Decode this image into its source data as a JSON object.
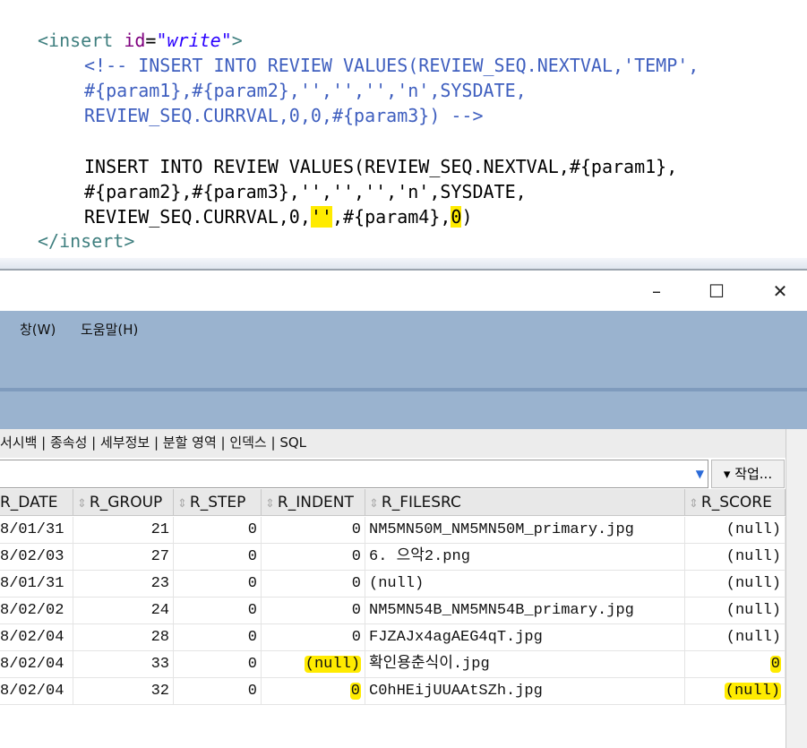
{
  "code": {
    "lines": [
      {
        "parts": [
          [
            "tag",
            "<insert "
          ],
          [
            "attr",
            "id"
          ],
          [
            "sql",
            "="
          ],
          [
            "val",
            "\"write\""
          ],
          [
            "tag",
            ">"
          ]
        ]
      },
      {
        "parts": [
          [
            "cmt",
            "<!-- INSERT INTO REVIEW VALUES(REVIEW_SEQ.NEXTVAL,'TEMP',"
          ]
        ]
      },
      {
        "parts": [
          [
            "cmt",
            "#{param1},#{param2},'','','','n',SYSDATE,"
          ]
        ]
      },
      {
        "parts": [
          [
            "cmt",
            "REVIEW_SEQ.CURRVAL,0,0,#{param3}) -->"
          ]
        ]
      },
      {
        "parts": []
      },
      {
        "parts": [
          [
            "sql",
            "INSERT INTO REVIEW VALUES(REVIEW_SEQ.NEXTVAL,#{param1},"
          ]
        ]
      },
      {
        "parts": [
          [
            "sql",
            "#{param2},#{param3},'','','','n',SYSDATE,"
          ]
        ]
      },
      {
        "parts": [
          [
            "sql",
            "REVIEW_SEQ.CURRVAL,0,"
          ],
          [
            "hl",
            "''"
          ],
          [
            "sql",
            ",#{param4},"
          ],
          [
            "hl",
            "0"
          ],
          [
            "sql",
            ")"
          ]
        ]
      },
      {
        "parts": [
          [
            "tag",
            "</insert>"
          ]
        ]
      }
    ]
  },
  "window": {
    "minimize": "–",
    "maximize": "☐",
    "close": "✕"
  },
  "menu": {
    "window": "창(W)",
    "help": "도움말(H)"
  },
  "tabs": "서시백 | 종속성 | 세부정보 | 분할 영역 | 인덱스 | SQL",
  "actions_label": "▾ 작업...",
  "filter_dropdown": "▼",
  "table": {
    "columns": [
      "R_DATE",
      "R_GROUP",
      "R_STEP",
      "R_INDENT",
      "R_FILESRC",
      "R_SCORE"
    ],
    "rows": [
      [
        "8/01/31",
        "21",
        "0",
        "0",
        "NM5MN50M_NM5MN50M_primary.jpg",
        "(null)"
      ],
      [
        "8/02/03",
        "27",
        "0",
        "0",
        "6. 으악2.png",
        "(null)"
      ],
      [
        "8/01/31",
        "23",
        "0",
        "0",
        "(null)",
        "(null)"
      ],
      [
        "8/02/02",
        "24",
        "0",
        "0",
        "NM5MN54B_NM5MN54B_primary.jpg",
        "(null)"
      ],
      [
        "8/02/04",
        "28",
        "0",
        "0",
        "FJZAJx4agAEG4qT.jpg",
        "(null)"
      ],
      [
        "8/02/04",
        "33",
        "0",
        "(null)",
        "확인용춘식이.jpg",
        "0"
      ],
      [
        "8/02/04",
        "32",
        "0",
        "0",
        "C0hHEijUUAAtSZh.jpg",
        "(null)"
      ]
    ],
    "highlighted": [
      [
        5,
        3
      ],
      [
        5,
        5
      ],
      [
        6,
        3
      ],
      [
        6,
        5
      ]
    ],
    "highlight_color": "#ffeb00"
  }
}
